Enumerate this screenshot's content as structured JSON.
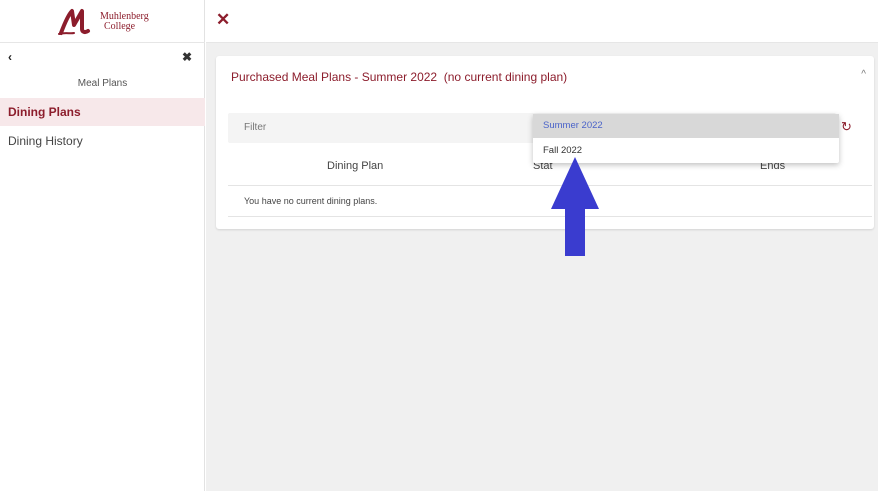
{
  "brand": {
    "line1": "Muhlenberg",
    "line2": "College",
    "color": "#8c1d2c"
  },
  "sidebar": {
    "back_icon": "‹",
    "close_icon": "✖",
    "section_title": "Meal Plans",
    "items": [
      {
        "label": "Dining Plans",
        "active": true
      },
      {
        "label": "Dining History",
        "active": false
      }
    ]
  },
  "topbar": {
    "close_icon": "✕"
  },
  "card": {
    "title": "Purchased Meal Plans - Summer 2022  (no current dining plan)",
    "collapse_icon": "^",
    "filter_label": "Filter",
    "refresh_icon": "↻",
    "columns": [
      "Dining Plan",
      "Stat",
      "Ends"
    ],
    "empty_message": "You have no current dining plans."
  },
  "dropdown": {
    "options": [
      "Summer 2022",
      "Fall 2022"
    ],
    "selected": "Summer 2022"
  },
  "annotation": {
    "arrow_color": "#3a3ccf",
    "icon": "arrow-up-icon"
  }
}
